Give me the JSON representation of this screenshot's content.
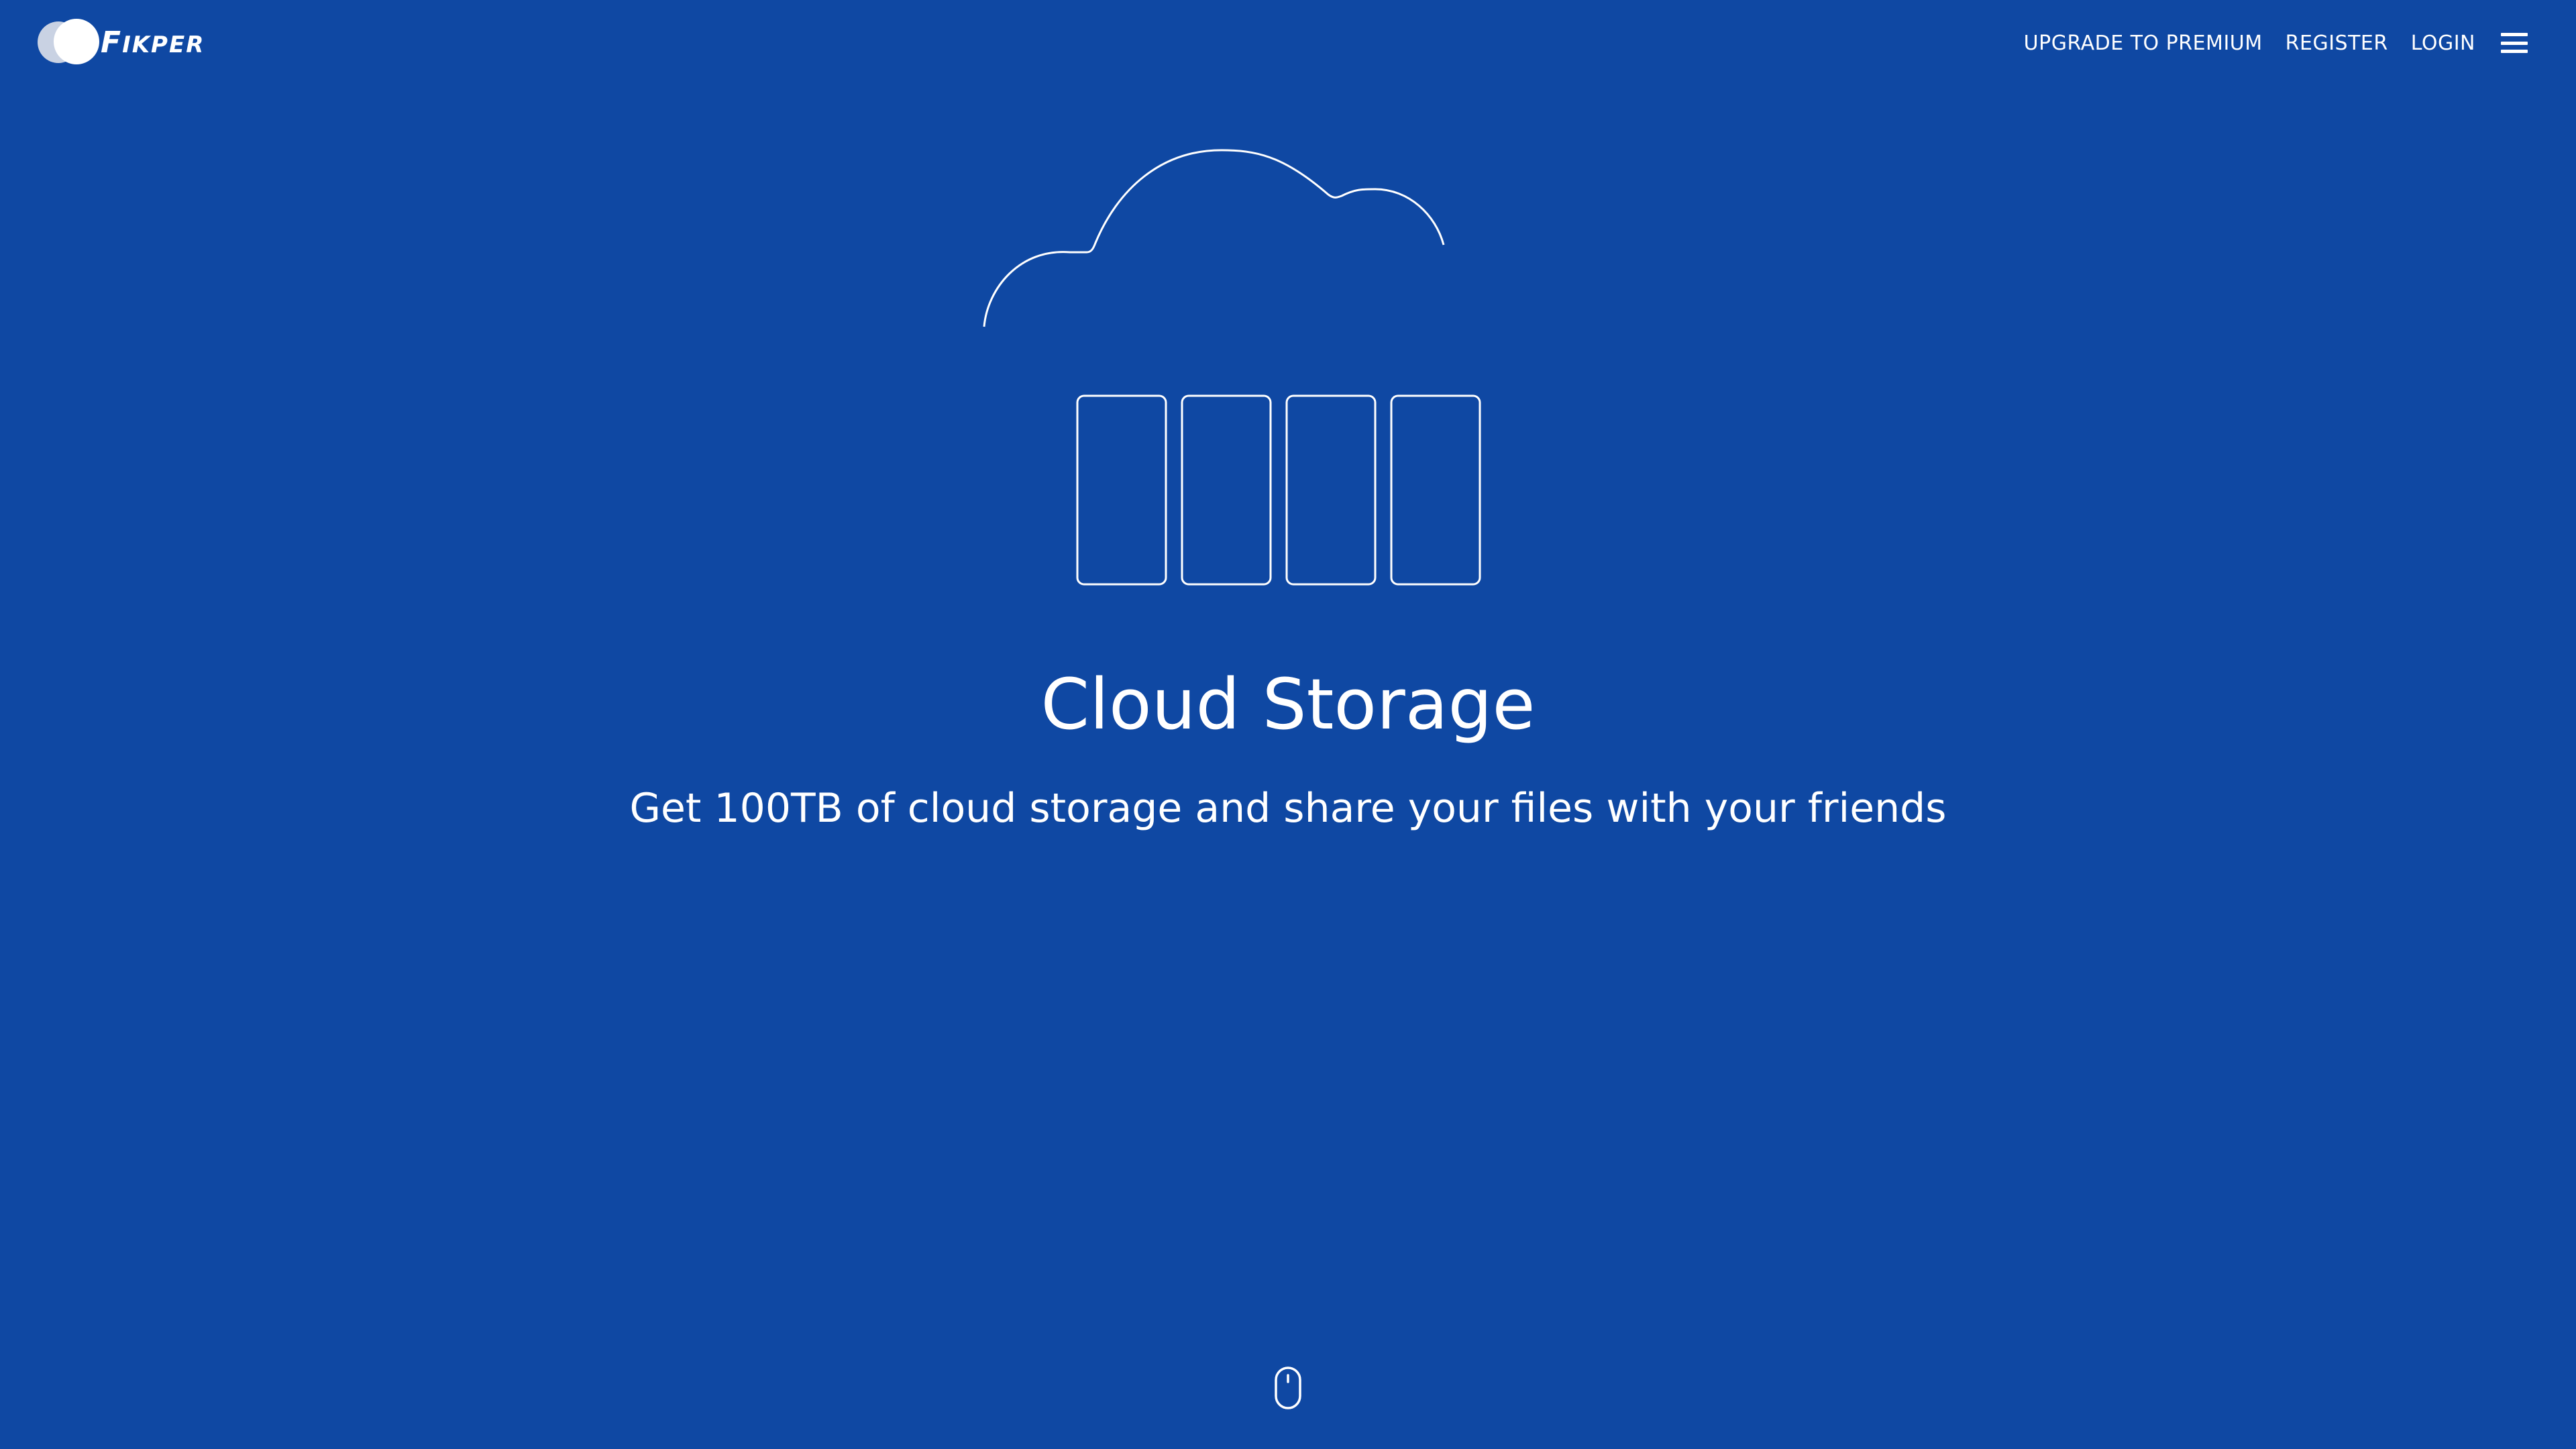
{
  "header": {
    "logo_text_big": "F",
    "logo_text_small": "IKPER",
    "nav": {
      "upgrade": "UPGRADE TO PREMIUM",
      "register": "REGISTER",
      "login": "LOGIN"
    },
    "menu_icon": "hamburger-menu-icon"
  },
  "hero": {
    "illustration_icon": "cloud-storage-icon",
    "title": "Cloud Storage",
    "subtitle": "Get 100TB of cloud storage and share your files with your friends"
  },
  "scroll_icon": "mouse-scroll-icon",
  "colors": {
    "background": "#0f48a3",
    "foreground": "#ffffff"
  }
}
